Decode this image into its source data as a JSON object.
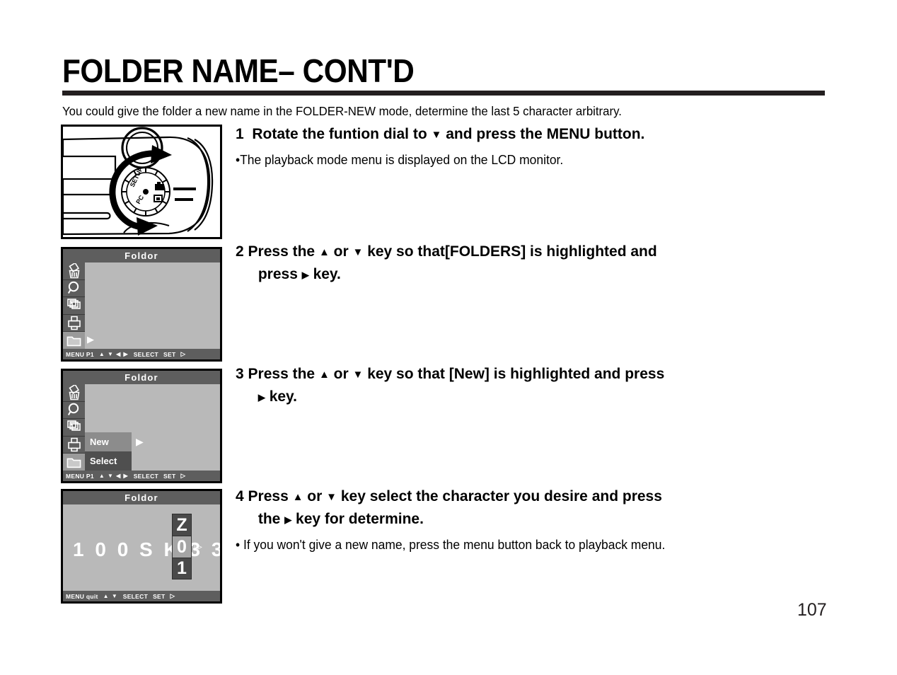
{
  "document": {
    "title": "FOLDER NAME– CONT'D",
    "intro": "You could give the folder a new name in the FOLDER-NEW mode, determine the last 5 character arbitrary.",
    "page_number": "107"
  },
  "glyphs": {
    "up": "▲",
    "down": "▼",
    "left": "◀",
    "right": "▶",
    "right_outline": "▷",
    "bullet": "•"
  },
  "steps": [
    {
      "number": "1",
      "head_part1": "Rotate the funtion dial to",
      "head_glyph": "▼",
      "head_part2": "and press the MENU button.",
      "note": "•The playback mode menu is displayed on the LCD monitor."
    },
    {
      "number": "2",
      "line1_a": "Press the",
      "line1_g1": "▲",
      "line1_b": "or",
      "line1_g2": "▼",
      "line1_c": "key so that[FOLDERS] is highlighted and",
      "line2_a": "press",
      "line2_g1": "▶",
      "line2_b": "key.",
      "note": ""
    },
    {
      "number": "3",
      "line1_a": "Press the",
      "line1_g1": "▲",
      "line1_b": "or",
      "line1_g2": "▼",
      "line1_c": "key so that [New] is highlighted and press",
      "line2_g1": "▶",
      "line2_b": "key.",
      "note": ""
    },
    {
      "number": "4",
      "line1_a": "Press",
      "line1_g1": "▲",
      "line1_b": "or",
      "line1_g2": "▼",
      "line1_c": "key select the character you desire and press",
      "line2_a": "the",
      "line2_g1": "▶",
      "line2_b": "key for determine.",
      "note": "• If you won't give a new name, press the menu button back to playback menu."
    }
  ],
  "figures": {
    "camera": {
      "caption": "camera body with mode dial",
      "dial_labels": [
        "SETUP",
        "PC"
      ]
    },
    "lcd_menu": {
      "title": "Foldor",
      "icons": [
        "trash-icon",
        "magnifier-icon",
        "slideshow-icon",
        "printer-icon",
        "folder-icon"
      ],
      "selected_icon": "folder-icon",
      "footer": {
        "menu_label": "MENU P1",
        "keys": "▲ ▼ ◀ ▶",
        "select_label": "SELECT",
        "set_label": "SET",
        "set_glyph": "▷"
      }
    },
    "lcd_submenu": {
      "title": "Foldor",
      "items": [
        {
          "label": "New",
          "state": "highlight"
        },
        {
          "label": "Select",
          "state": "normal"
        }
      ],
      "footer": {
        "menu_label": "MENU P1",
        "keys": "▲ ▼ ◀ ▶",
        "select_label": "SELECT",
        "set_label": "SET",
        "set_glyph": "▷"
      }
    },
    "lcd_chars": {
      "title": "Foldor",
      "name_prefix": "1 0 0 S K 3 3",
      "spinner": [
        {
          "value": "Z",
          "state": "dim"
        },
        {
          "value": "0",
          "state": "sel"
        },
        {
          "value": "1",
          "state": "dim"
        }
      ],
      "footer": {
        "menu_label": "MENU quit",
        "keys": "▲ ▼",
        "select_label": "SELECT",
        "set_label": "SET",
        "set_glyph": "▷"
      }
    }
  }
}
